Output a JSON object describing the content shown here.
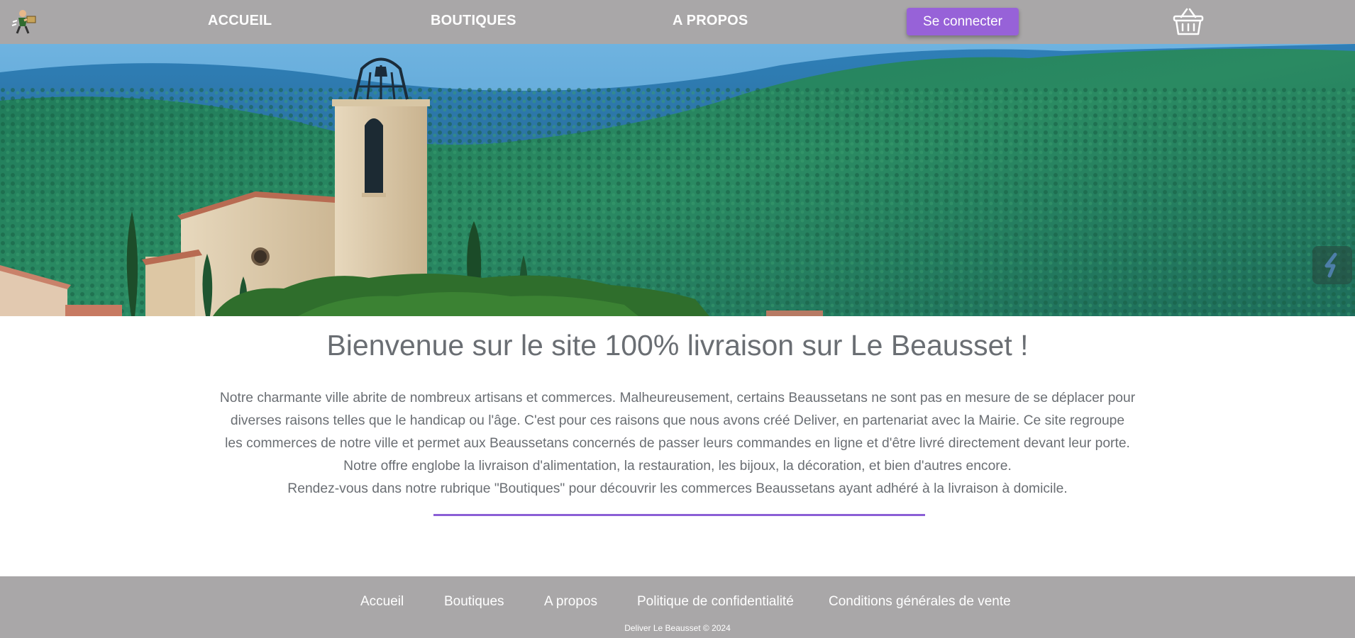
{
  "header": {
    "logo_icon": "delivery-person-logo",
    "nav": {
      "accueil": "ACCUEIL",
      "boutiques": "BOUTIQUES",
      "apropos": "A PROPOS"
    },
    "login_label": "Se connecter",
    "cart_icon": "basket-icon",
    "accent_color": "#9762d8"
  },
  "hero": {
    "image": "village-church-bell-tower-forest-hills"
  },
  "main": {
    "title": "Bienvenue sur le site 100% livraison sur Le Beausset !",
    "paragraph": [
      "Notre charmante ville abrite de nombreux artisans et commerces. Malheureusement, certains Beaussetans ne sont pas en mesure de se déplacer pour",
      "diverses raisons telles que le handicap ou l'âge. C'est pour ces raisons que nous avons créé Deliver, en partenariat avec la Mairie. Ce site regroupe",
      "les commerces de notre ville et permet aux Beaussetans concernés de passer leurs commandes en ligne et d'être livré directement devant leur porte.",
      "Notre offre englobe la livraison d'alimentation, la restauration, les bijoux, la décoration, et bien d'autres encore.",
      "Rendez-vous dans notre rubrique \"Boutiques\" pour découvrir les commerces Beaussetans ayant adhéré à la livraison à domicile."
    ]
  },
  "footer": {
    "links": {
      "accueil": "Accueil",
      "boutiques": "Boutiques",
      "apropos": "A propos",
      "privacy": "Politique de confidentialité",
      "cgv": "Conditions générales de vente"
    },
    "copyright": "Deliver Le Beausset © 2024"
  }
}
